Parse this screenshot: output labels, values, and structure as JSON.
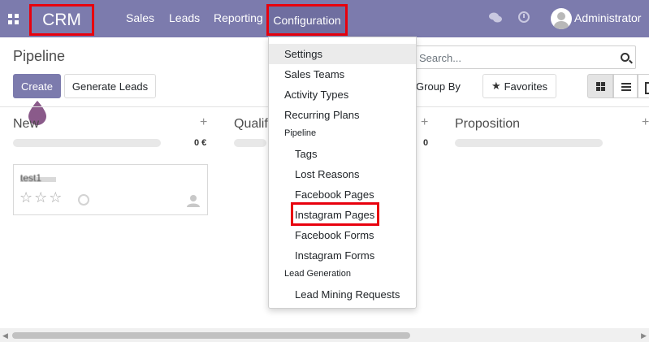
{
  "navbar": {
    "brand": "CRM",
    "items": [
      {
        "label": "Sales"
      },
      {
        "label": "Leads"
      },
      {
        "label": "Reporting"
      },
      {
        "label": "Configuration"
      }
    ],
    "user": "Administrator",
    "icons": {
      "apps": "apps-grid-icon",
      "chat": "chat-bubbles-icon",
      "activity": "clock-icon",
      "avatar": "user-avatar"
    }
  },
  "control_panel": {
    "breadcrumb": "Pipeline",
    "create_label": "Create",
    "generate_leads_label": "Generate Leads",
    "search_placeholder": "Search...",
    "group_by_label": "Group By",
    "favorites_label": "Favorites"
  },
  "kanban": {
    "columns": [
      {
        "title": "New",
        "total": "0 €"
      },
      {
        "title": "Qualif",
        "total": "0"
      },
      {
        "title": "Proposition",
        "total": ""
      }
    ],
    "card": {
      "title": "test1",
      "stars": "☆☆☆"
    }
  },
  "menu": {
    "items": [
      {
        "label": "Settings"
      },
      {
        "label": "Sales Teams"
      },
      {
        "label": "Activity Types"
      },
      {
        "label": "Recurring Plans"
      }
    ],
    "pipeline_header": "Pipeline",
    "pipeline_items": [
      {
        "label": "Tags"
      },
      {
        "label": "Lost Reasons"
      },
      {
        "label": "Facebook Pages"
      },
      {
        "label": "Instagram Pages"
      },
      {
        "label": "Facebook Forms"
      },
      {
        "label": "Instagram Forms"
      }
    ],
    "lead_gen_header": "Lead Generation",
    "lead_gen_items": [
      {
        "label": "Lead Mining Requests"
      }
    ]
  },
  "colors": {
    "navbar": "#7c7bad",
    "highlight": "#e8000d",
    "primary_button": "#7c7bad"
  }
}
